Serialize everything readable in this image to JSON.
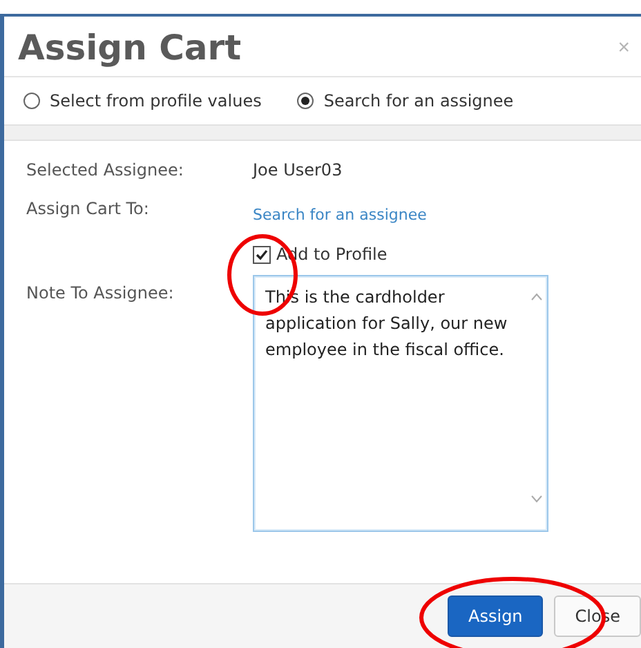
{
  "dialog": {
    "title": "Assign Cart",
    "close": "×"
  },
  "source_options": [
    {
      "label": "Select from profile values",
      "selected": false
    },
    {
      "label": "Search for an assignee",
      "selected": true
    }
  ],
  "fields": [
    {
      "label": "Selected Assignee:",
      "kind": "text",
      "value": "Joe User03"
    },
    {
      "label": "Assign Cart To:",
      "kind": "link",
      "value": "Search for an assignee"
    }
  ],
  "add_to_profile": {
    "label": "Add to Profile",
    "checked": true
  },
  "note": {
    "label": "Note To Assignee:",
    "value": "This is the cardholder application for Sally, our new employee in the fiscal office."
  },
  "buttons": [
    {
      "label": "Assign",
      "kind": "primary"
    },
    {
      "label": "Close",
      "kind": "default"
    }
  ]
}
